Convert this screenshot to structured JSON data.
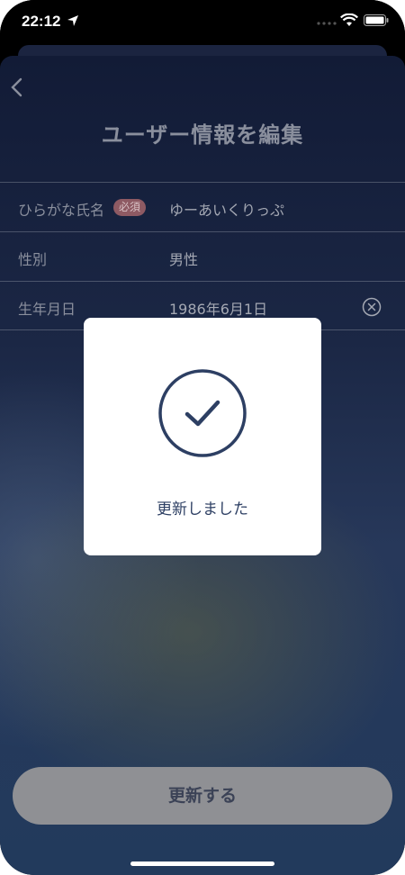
{
  "status_bar": {
    "time": "22:12",
    "icons": [
      "location-arrow-icon",
      "signal-dots-icon",
      "wifi-icon",
      "battery-icon"
    ]
  },
  "header": {
    "title": "ユーザー情報を編集",
    "back_icon": "chevron-left-icon"
  },
  "form": {
    "rows": [
      {
        "label": "ひらがな氏名",
        "badge": "必須",
        "value": "ゆーあいくりっぷ"
      },
      {
        "label": "性別",
        "value": "男性"
      },
      {
        "label": "生年月日",
        "value": "1986年6月1日",
        "clear_icon": "clear-circle-icon"
      }
    ]
  },
  "update_button": {
    "label": "更新する"
  },
  "modal": {
    "icon": "check-circle-icon",
    "message": "更新しました"
  },
  "colors": {
    "sheet_background": "#1b2745",
    "modal_accent": "#2d3f63",
    "required_badge": "#8e5a63",
    "button_disabled": "#8f9094"
  }
}
